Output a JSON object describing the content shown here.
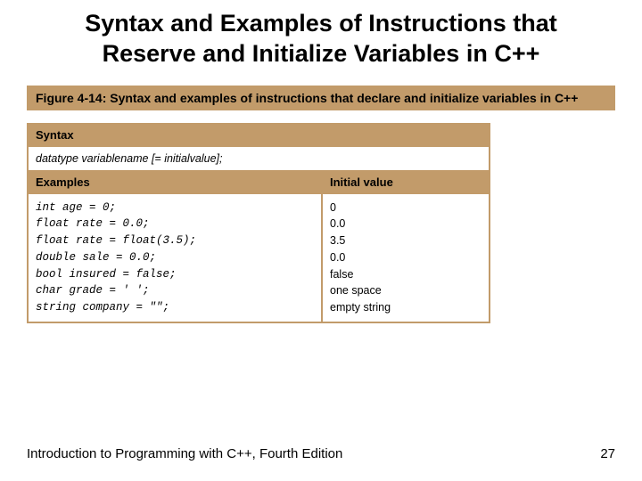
{
  "title": "Syntax and Examples of Instructions that Reserve and Initialize Variables in C++",
  "figure_caption": "Figure 4-14: Syntax and examples of instructions that declare and initialize variables in C++",
  "headers": {
    "syntax": "Syntax",
    "examples": "Examples",
    "initial_value": "Initial value"
  },
  "syntax_line": "datatype variablename [= initialvalue];",
  "examples": [
    {
      "code": "int age = 0;",
      "value": "0"
    },
    {
      "code": "float rate = 0.0;",
      "value": "0.0"
    },
    {
      "code": "float rate = float(3.5);",
      "value": "3.5"
    },
    {
      "code": "double sale = 0.0;",
      "value": "0.0"
    },
    {
      "code": "bool insured = false;",
      "value": "false"
    },
    {
      "code": "char grade = ' ';",
      "value": "one space"
    },
    {
      "code": "string company = \"\";",
      "value": "empty string"
    }
  ],
  "footer": {
    "left": "Introduction to Programming with C++, Fourth Edition",
    "page": "27"
  }
}
